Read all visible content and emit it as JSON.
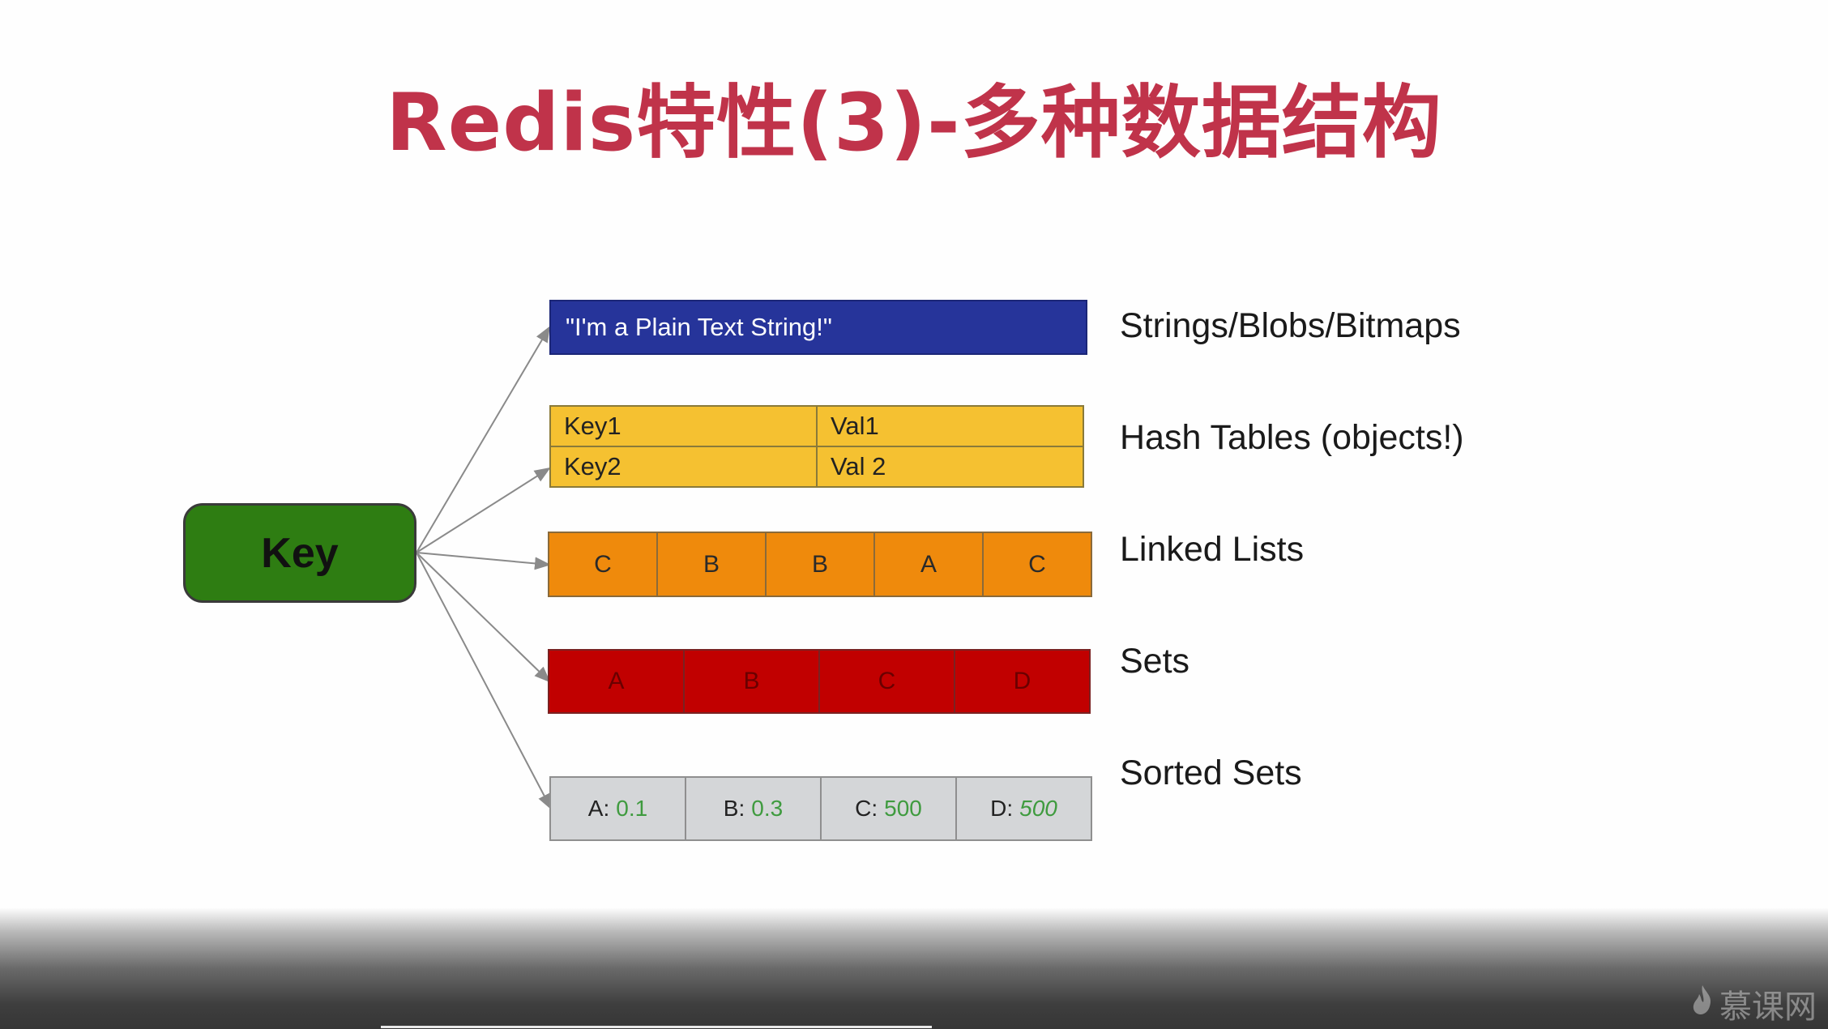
{
  "title": "Redis特性(3)-多种数据结构",
  "key": {
    "label": "Key"
  },
  "string_row": {
    "text": "\"I'm a Plain Text String!\""
  },
  "hash_table": {
    "rows": [
      {
        "key": "Key1",
        "value": "Val1"
      },
      {
        "key": "Key2",
        "value": "Val 2"
      }
    ]
  },
  "linked_list": {
    "items": [
      "C",
      "B",
      "B",
      "A",
      "C"
    ]
  },
  "set": {
    "items": [
      "A",
      "B",
      "C",
      "D"
    ]
  },
  "sorted_set": {
    "items": [
      {
        "member": "A:",
        "score": "0.1"
      },
      {
        "member": "B:",
        "score": "0.3"
      },
      {
        "member": "C:",
        "score": "500"
      },
      {
        "member": "D:",
        "score": "500"
      }
    ]
  },
  "labels": {
    "strings": "Strings/Blobs/Bitmaps",
    "hash_tables": "Hash Tables (objects!)",
    "linked_lists": "Linked Lists",
    "sets": "Sets",
    "sorted_sets": "Sorted Sets"
  },
  "watermark": {
    "text": "慕课网"
  },
  "colors": {
    "title": "#c0334a",
    "key_box": "#2e7d12",
    "string_bg": "#26349a",
    "hash_bg": "#f5c131",
    "list_bg": "#ef8a0c",
    "set_bg": "#c10000",
    "sorted_bg": "#d4d6d8",
    "score_text": "#3f9b3f"
  }
}
